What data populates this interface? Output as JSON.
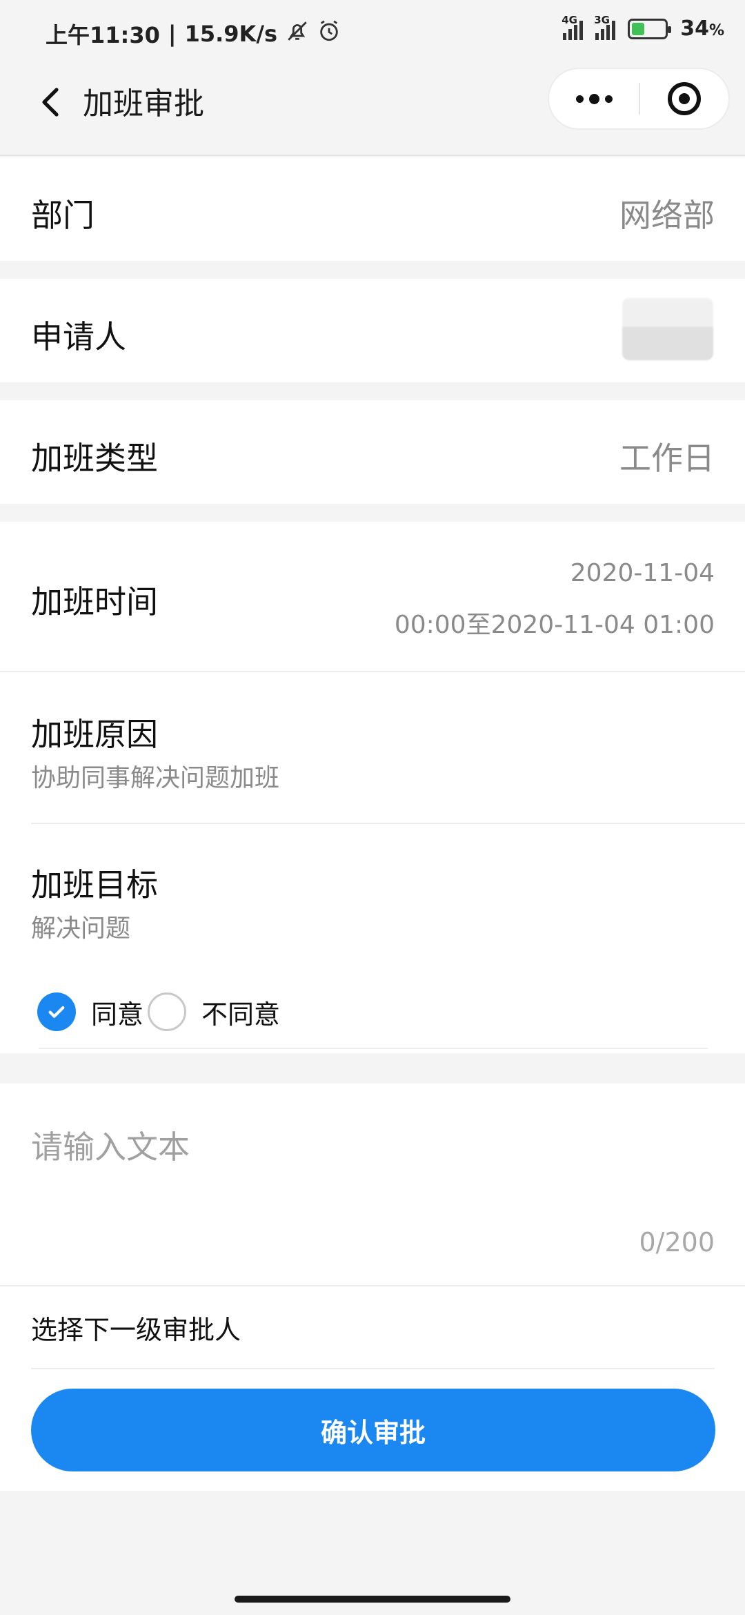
{
  "status_bar": {
    "time": "上午11:30",
    "speed": "15.9K/s",
    "signal1_tag": "4G",
    "signal2_tag": "3G",
    "battery_percent": "34",
    "battery_unit": "%",
    "battery_level": 0.34,
    "icons": [
      "bell-off-icon",
      "alarm-icon",
      "signal-icon",
      "battery-charging-icon"
    ]
  },
  "nav": {
    "title": "加班审批",
    "back_icon": "chevron-left-icon",
    "more_icon": "more-dots-icon",
    "close_icon": "target-close-icon"
  },
  "form": {
    "department": {
      "label": "部门",
      "value": "网络部"
    },
    "applicant": {
      "label": "申请人",
      "value": ""
    },
    "ot_type": {
      "label": "加班类型",
      "value": "工作日"
    },
    "ot_time": {
      "label": "加班时间",
      "value_line1": "2020-11-04",
      "value_line2": "00:00至2020-11-04 01:00"
    },
    "ot_reason": {
      "label": "加班原因",
      "value": "协助同事解决问题加班"
    },
    "ot_goal": {
      "label": "加班目标",
      "value": "解决问题"
    },
    "decision": {
      "agree_label": "同意",
      "disagree_label": "不同意",
      "selected": "同意"
    },
    "comment": {
      "placeholder": "请输入文本",
      "counter": "0/200"
    },
    "next_approver": {
      "label": "选择下一级审批人"
    },
    "confirm_button": "确认审批"
  },
  "colors": {
    "accent": "#1a88f0",
    "background": "#f4f4f4",
    "muted_text": "#8a8a8a"
  }
}
